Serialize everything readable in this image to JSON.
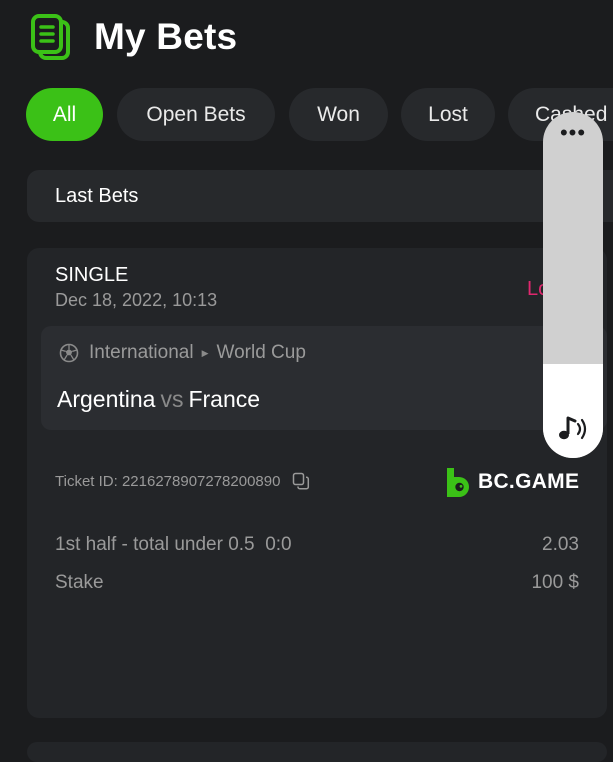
{
  "header": {
    "title": "My Bets",
    "icon": "bets-list-icon",
    "accent": "#3bc117"
  },
  "tabs": [
    {
      "label": "All",
      "active": true
    },
    {
      "label": "Open Bets",
      "active": false
    },
    {
      "label": "Won",
      "active": false
    },
    {
      "label": "Lost",
      "active": false
    },
    {
      "label": "Cashed",
      "active": false
    }
  ],
  "section": {
    "label": "Last Bets"
  },
  "bet": {
    "type": "SINGLE",
    "date": "Dec 18, 2022, 10:13",
    "status": "Lost",
    "status_color": "#e0276e",
    "sport_icon": "soccer-ball-icon",
    "category": "International",
    "league": "World Cup",
    "home": "Argentina",
    "vs": "vs",
    "away": "France",
    "ticket_label": "Ticket ID: 2216278907278200890",
    "brand": "BC.GAME",
    "selection": "1st half - total under 0.5",
    "score": "0:0",
    "odds": "2.03",
    "stake_label": "Stake",
    "stake_value": "100 $"
  },
  "overlay": {
    "more_icon": "ellipsis-icon",
    "more_label": "•••",
    "sound_icon": "sound-icon"
  }
}
